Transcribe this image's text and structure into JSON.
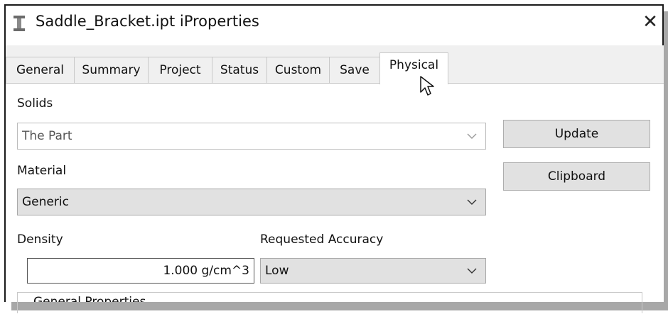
{
  "window": {
    "title": "Saddle_Bracket.ipt iProperties",
    "close_symbol": "✕",
    "app_icon": "inventor-ipt-icon"
  },
  "tabs": [
    {
      "label": "General"
    },
    {
      "label": "Summary"
    },
    {
      "label": "Project"
    },
    {
      "label": "Status"
    },
    {
      "label": "Custom"
    },
    {
      "label": "Save"
    },
    {
      "label": "Physical",
      "active": true
    }
  ],
  "physical": {
    "solids_label": "Solids",
    "solids_value": "The Part",
    "material_label": "Material",
    "material_value": "Generic",
    "density_label": "Density",
    "density_value": "1.000 g/cm^3",
    "accuracy_label": "Requested Accuracy",
    "accuracy_value": "Low",
    "update_button": "Update",
    "clipboard_button": "Clipboard",
    "general_properties_label": "General Properties"
  },
  "colors": {
    "window_border": "#1a1a1a",
    "panel_bg": "#ffffff",
    "control_bg": "#e1e1e1"
  }
}
